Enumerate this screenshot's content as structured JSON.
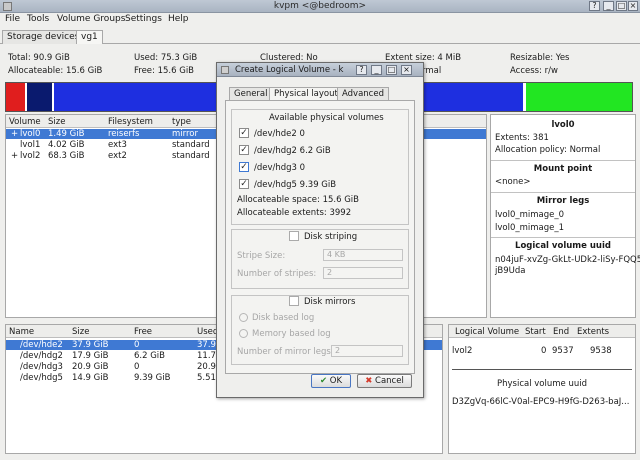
{
  "window": {
    "title": "kvpm <@bedroom>"
  },
  "menu": [
    "File",
    "Tools",
    "Volume Groups",
    "Settings",
    "Help"
  ],
  "tabs": [
    "Storage devices",
    "vg1"
  ],
  "summary": {
    "total": "Total: 90.9 GiB",
    "allocateable": "Allocateable: 15.6 GiB",
    "used": "Used: 75.3 GiB",
    "free": "Free: 15.6 GiB",
    "clustered": "Clustered: No",
    "policy": "Policy: Normal",
    "extent_size": "Extent size: 4 MiB",
    "format_partial": "rmal",
    "resizable": "Resizable: Yes",
    "access": "Access: r/w"
  },
  "colors": {
    "red": "#e01e1e",
    "navy": "#0a1a6e",
    "blue": "#1e2fe0",
    "green": "#22e622",
    "selection": "#3f79d3"
  },
  "lv_table": {
    "headers": [
      "Volume",
      "Size",
      "Filesystem",
      "type"
    ],
    "rows": [
      {
        "expand": "+",
        "name": "lvol0",
        "size": "1.49 GiB",
        "fs": "reiserfs",
        "type": "mirror"
      },
      {
        "expand": "",
        "name": "lvol1",
        "size": "4.02 GiB",
        "fs": "ext3",
        "type": "standard"
      },
      {
        "expand": "+",
        "name": "lvol2",
        "size": "68.3 GiB",
        "fs": "ext2",
        "type": "standard"
      }
    ]
  },
  "lv_props": {
    "name": "lvol0",
    "extents": "Extents: 381",
    "policy": "Allocation policy: Normal",
    "mount_head": "Mount point",
    "mount": "<none>",
    "mirror_head": "Mirror legs",
    "mirror1": "lvol0_mimage_0",
    "mirror2": "lvol0_mimage_1",
    "uuid_head": "Logical volume uuid",
    "uuid1": "n04juF-xvZg-GkLt-UDk2-liSy-FQQ5-",
    "uuid2": "jB9Uda"
  },
  "pv_table": {
    "headers": [
      "Name",
      "Size",
      "Free",
      "Used"
    ],
    "rows": [
      {
        "name": "/dev/hde2",
        "size": "37.9 GiB",
        "free": "0",
        "used": "37.9"
      },
      {
        "name": "/dev/hdg2",
        "size": "17.9 GiB",
        "free": "6.2 GiB",
        "used": "11.7"
      },
      {
        "name": "/dev/hdg3",
        "size": "20.9 GiB",
        "free": "0",
        "used": "20.9"
      },
      {
        "name": "/dev/hdg5",
        "size": "14.9 GiB",
        "free": "9.39 GiB",
        "used": "5.51"
      }
    ]
  },
  "seg_table": {
    "headers": [
      "Logical Volume",
      "Start",
      "End",
      "Extents"
    ],
    "row": {
      "lv": "lvol2",
      "start": "0",
      "end": "9537",
      "extents": "9538"
    },
    "uuid_head": "Physical volume uuid",
    "uuid": "D3ZgVq-66lC-V0al-EPC9-H9fG-D263-baJ..."
  },
  "dialog": {
    "title": "Create Logical Volume - k",
    "tabs": [
      "General",
      "Physical layout",
      "Advanced"
    ],
    "pv_group": "Available physical volumes",
    "pvs": [
      "/dev/hde2 0",
      "/dev/hdg2 6.2 GiB",
      "/dev/hdg3 0",
      "/dev/hdg5 9.39 GiB"
    ],
    "alloc_space": "Allocateable space: 15.6 GiB",
    "alloc_extents": "Allocateable extents: 3992",
    "striping": "Disk striping",
    "stripe_size_label": "Stripe Size:",
    "stripe_size": "4 KB",
    "stripes_label": "Number of stripes:",
    "stripes": "2",
    "mirrors": "Disk mirrors",
    "disk_log": "Disk based log",
    "mem_log": "Memory based log",
    "legs_label": "Number of mirror legs:",
    "legs": "2",
    "ok": "OK",
    "cancel": "Cancel"
  }
}
